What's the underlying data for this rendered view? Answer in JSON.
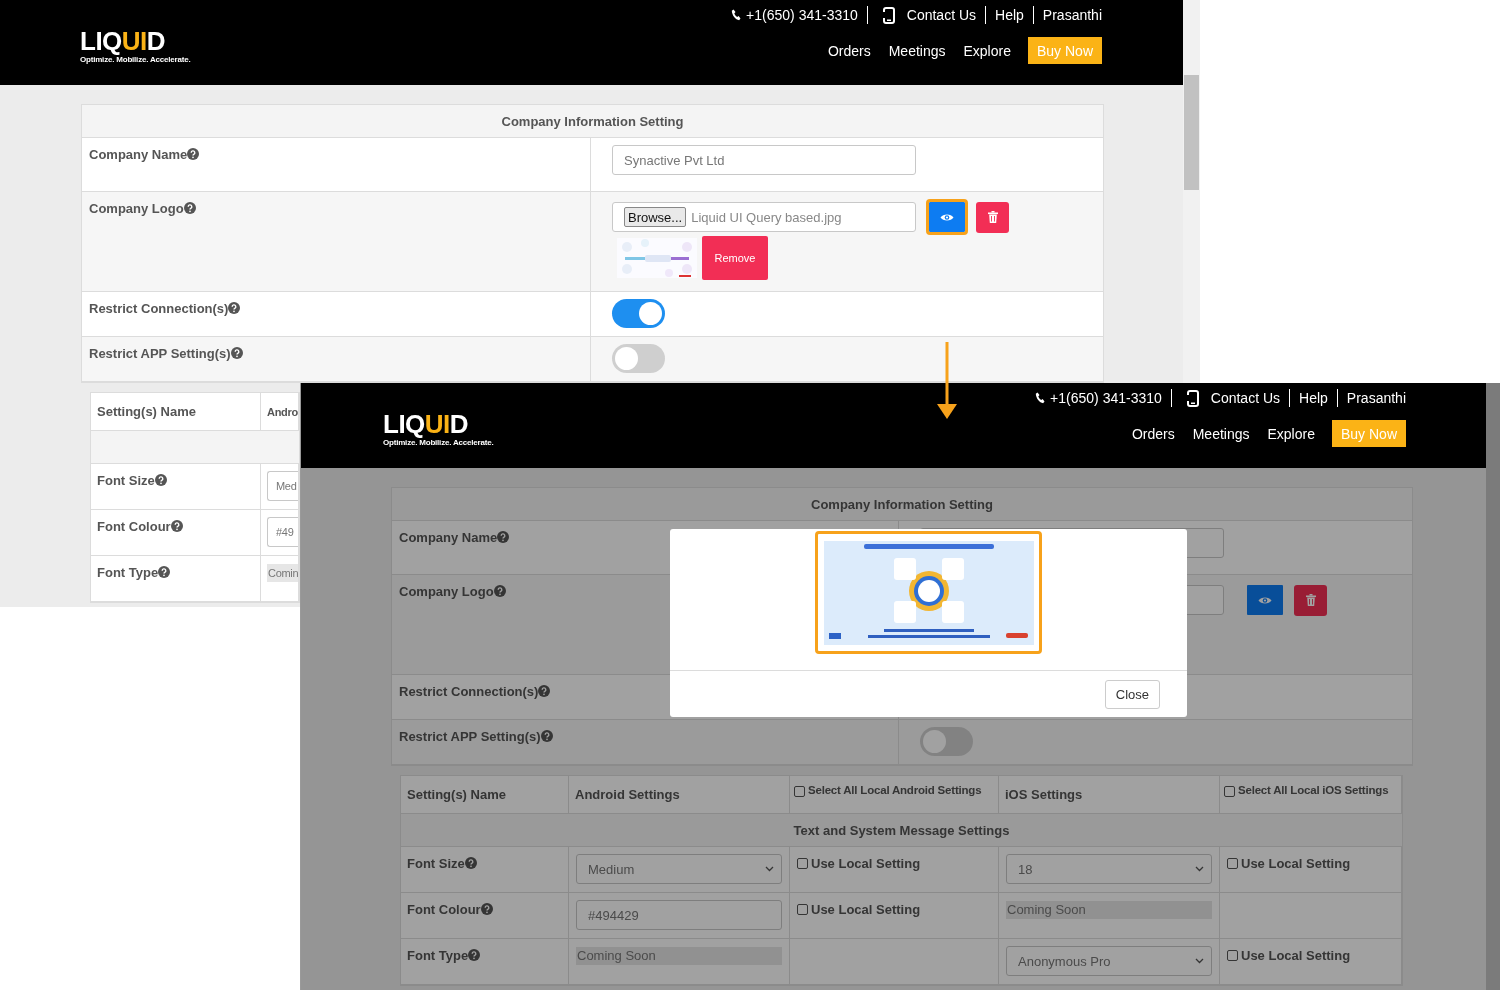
{
  "screens": [
    {
      "header": {
        "logo": {
          "parts": [
            {
              "text": "LIQ",
              "accent": false
            },
            {
              "text": "UI",
              "accent": true
            },
            {
              "text": "D",
              "accent": false
            }
          ],
          "tagline": "Optimize. Mobilize. Accelerate."
        },
        "phone": "+1(650) 341-3310",
        "links": [
          {
            "label": "Contact Us",
            "kind": "icon"
          },
          {
            "label": "Help",
            "kind": "text"
          },
          {
            "label": "Prasanthi",
            "kind": "text"
          }
        ],
        "nav": [
          "Orders",
          "Meetings",
          "Explore"
        ],
        "cta": "Buy Now"
      },
      "company_settings": {
        "title": "Company Information Setting",
        "rows": [
          {
            "label": "Company Name",
            "kind": "text",
            "value": "Synactive Pvt Ltd"
          },
          {
            "label": "Company Logo",
            "kind": "file",
            "browse": "Browse...",
            "file": "Liquid UI Query based.jpg",
            "view_highlighted": true,
            "preview": {
              "kind": "picture"
            },
            "remove": "Remove"
          },
          {
            "label": "Restrict Connection(s)",
            "kind": "toggle",
            "on": true
          },
          {
            "label": "Restrict APP Setting(s)",
            "kind": "toggle",
            "on": false
          }
        ]
      },
      "settings_table": {
        "columns": [
          {
            "label": "Setting(s) Name"
          },
          {
            "label": "Andro"
          }
        ],
        "rows": [
          {
            "cells": [
              {
                "kind": "label",
                "value": "Font Size"
              },
              {
                "kind": "cut",
                "value": "Med"
              }
            ]
          },
          {
            "cells": [
              {
                "kind": "label",
                "value": "Font Colour"
              },
              {
                "kind": "cut",
                "value": "#49"
              }
            ]
          },
          {
            "cells": [
              {
                "kind": "label",
                "value": "Font Type"
              },
              {
                "kind": "readonly",
                "value": "Comin"
              }
            ]
          }
        ]
      }
    },
    {
      "header": {
        "logo": {
          "parts": [
            {
              "text": "LIQ",
              "accent": false
            },
            {
              "text": "UI",
              "accent": true
            },
            {
              "text": "D",
              "accent": false
            }
          ],
          "tagline": "Optimize. Mobilize. Accelerate."
        },
        "phone": "+1(650) 341-3310",
        "links": [
          {
            "label": "Contact Us",
            "kind": "icon"
          },
          {
            "label": "Help",
            "kind": "text"
          },
          {
            "label": "Prasanthi",
            "kind": "text"
          }
        ],
        "nav": [
          "Orders",
          "Meetings",
          "Explore"
        ],
        "cta": "Buy Now"
      },
      "company_settings": {
        "title": "Company Information Setting",
        "rows": [
          {
            "label": "Company Name",
            "kind": "text"
          },
          {
            "label": "Company Logo",
            "kind": "file",
            "view_highlighted": false
          },
          {
            "label": "Restrict Connection(s)",
            "kind": "toggle"
          },
          {
            "label": "Restrict APP Setting(s)",
            "kind": "toggle",
            "on": false
          }
        ]
      },
      "settings_table": {
        "columns": [
          {
            "label": "Setting(s) Name"
          },
          {
            "label": "Android Settings"
          },
          {
            "label": "Select All Local Android Settings",
            "kind": "checkbox",
            "checked": false
          },
          {
            "label": "iOS Settings"
          },
          {
            "label": "Select All Local iOS Settings",
            "kind": "checkbox",
            "checked": false
          }
        ],
        "section": "Text and System Message Settings",
        "rows": [
          {
            "cells": [
              {
                "kind": "label",
                "value": "Font Size"
              },
              {
                "kind": "select",
                "value": "Medium"
              },
              {
                "kind": "checkbox",
                "label": "Use Local Setting",
                "checked": false
              },
              {
                "kind": "select",
                "value": "18"
              },
              {
                "kind": "checkbox",
                "label": "Use Local Setting",
                "checked": false
              }
            ]
          },
          {
            "cells": [
              {
                "kind": "label",
                "value": "Font Colour"
              },
              {
                "kind": "text",
                "value": "#494429"
              },
              {
                "kind": "checkbox",
                "label": "Use Local Setting",
                "checked": false
              },
              {
                "kind": "readonly",
                "value": "Coming Soon"
              },
              {
                "kind": "empty"
              }
            ]
          },
          {
            "cells": [
              {
                "kind": "label",
                "value": "Font Type"
              },
              {
                "kind": "readonly",
                "value": "Coming Soon"
              },
              {
                "kind": "empty"
              },
              {
                "kind": "select",
                "value": "Anonymous Pro"
              },
              {
                "kind": "checkbox",
                "label": "Use Local Setting",
                "checked": false
              }
            ]
          }
        ]
      },
      "modal": {
        "image": {
          "kind": "picture",
          "highlighted": true
        },
        "close": "Close"
      }
    }
  ]
}
